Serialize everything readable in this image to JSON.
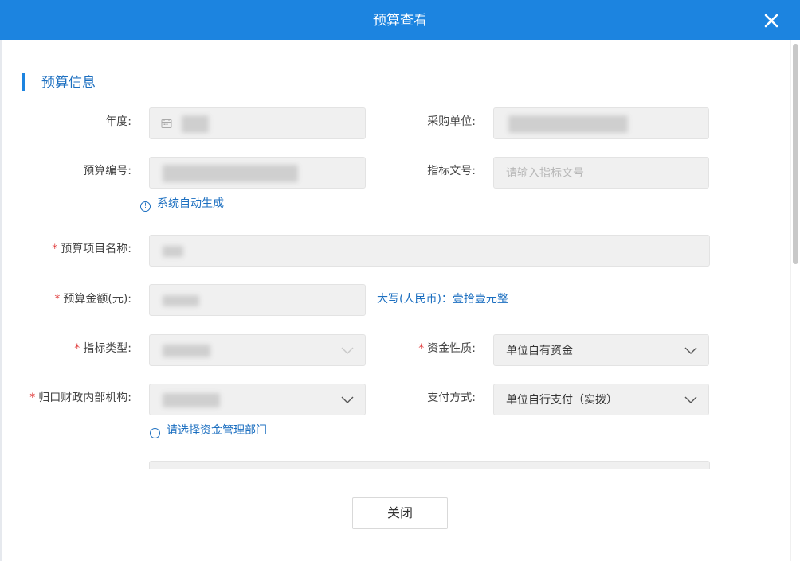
{
  "dialog": {
    "title": "预算查看"
  },
  "section": {
    "title": "预算信息"
  },
  "fields": {
    "year": {
      "label": "年度:"
    },
    "purchase_unit": {
      "label": "采购单位:"
    },
    "budget_code": {
      "label": "预算编号:",
      "hint": "系统自动生成"
    },
    "index_doc": {
      "label": "指标文号:",
      "placeholder": "请输入指标文号"
    },
    "project_name": {
      "label": "预算项目名称:",
      "required": "*"
    },
    "amount": {
      "label": "预算金额(元):",
      "required": "*",
      "capital_text": "大写(人民币)：壹拾壹元整"
    },
    "index_type": {
      "label": "指标类型:",
      "required": "*"
    },
    "fund_nature": {
      "label": "资金性质:",
      "required": "*",
      "value": "单位自有资金"
    },
    "finance_dept": {
      "label": "归口财政内部机构:",
      "required": "*",
      "hint": "请选择资金管理部门"
    },
    "payment_method": {
      "label": "支付方式:",
      "value": "单位自行支付（实拨）"
    }
  },
  "footer": {
    "close_label": "关闭"
  },
  "icons": {
    "close": "close-icon",
    "calendar": "calendar-icon",
    "info": "info-icon",
    "chevron": "chevron-down-icon"
  },
  "colors": {
    "header": "#1c84e0",
    "accent_text": "#1c6fc0",
    "required": "#e03c3c",
    "field_bg": "#f0f0f0"
  }
}
